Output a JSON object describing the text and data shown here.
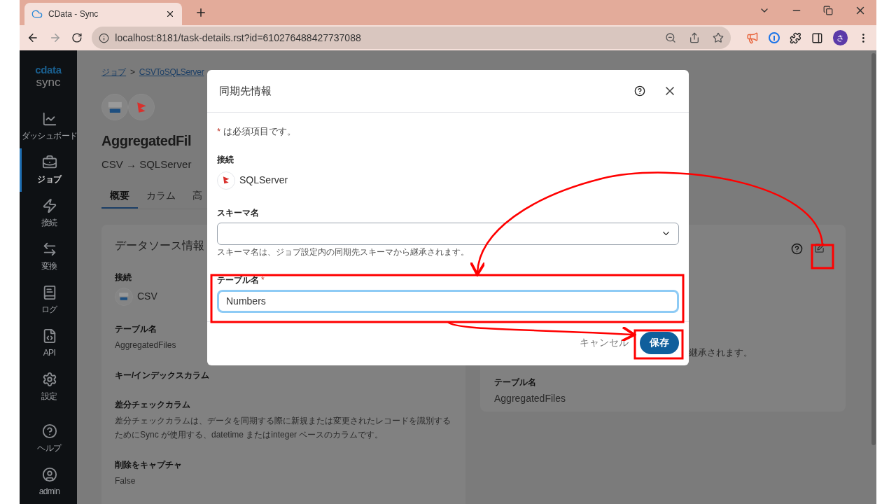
{
  "browser": {
    "tab_title": "CData - Sync",
    "url": "localhost:8181/task-details.rst?id=610276488427737088",
    "profile_initial": "さ"
  },
  "sidebar": {
    "logo_top": "cdata",
    "logo_bottom": "sync",
    "items": [
      {
        "label": "ダッシュボード",
        "selected": false
      },
      {
        "label": "ジョブ",
        "selected": true
      },
      {
        "label": "接続",
        "selected": false
      },
      {
        "label": "変換",
        "selected": false
      },
      {
        "label": "ログ",
        "selected": false
      },
      {
        "label": "API",
        "selected": false
      },
      {
        "label": "設定",
        "selected": false
      },
      {
        "label": "ヘルプ",
        "selected": false
      },
      {
        "label": "admin",
        "selected": false
      }
    ]
  },
  "breadcrumb": {
    "items": [
      "ジョブ",
      "CSVToSQLServer"
    ],
    "separator": ">"
  },
  "job": {
    "title": "AggregatedFil",
    "subtitle": "CSV → SQLServer"
  },
  "tabs": [
    {
      "label": "概要",
      "selected": true
    },
    {
      "label": "カラム",
      "selected": false
    },
    {
      "label": "高",
      "selected": false
    }
  ],
  "source_card": {
    "title": "データソース情報",
    "connection_label": "接続",
    "connection": "CSV",
    "fields": [
      {
        "label": "テーブル名",
        "value": "AggregatedFiles"
      },
      {
        "label": "キー/インデックスカラム"
      },
      {
        "label": "差分チェックカラム",
        "value": "差分チェックカラムは、データを同期する際に新規または変更されたレコードを識別するためにSync が使用する、datetime またはinteger ベースのカラムです。"
      },
      {
        "label": "削除をキャプチャ",
        "value": "False"
      }
    ]
  },
  "dest_card": {
    "hint_tail": "継承されます。",
    "table_label": "テーブル名",
    "table_value": "AggregatedFiles"
  },
  "dialog": {
    "title": "同期先情報",
    "required_mark": "*",
    "required_note": "は必須項目です。",
    "connection_label": "接続",
    "connection": "SQLServer",
    "schema_label": "スキーマ名",
    "schema_hint": "スキーマ名は、ジョブ設定内の同期先スキーマから継承されます。",
    "table_label": "テーブル名",
    "table_value": "Numbers",
    "cancel": "キャンセル",
    "save": "保存"
  }
}
